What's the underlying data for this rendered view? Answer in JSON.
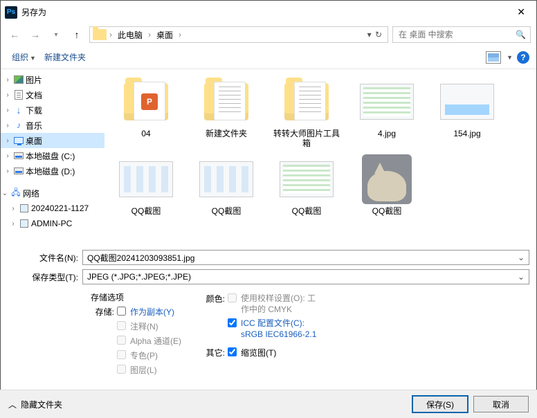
{
  "title": "另存为",
  "breadcrumb": {
    "pc": "此电脑",
    "loc": "桌面"
  },
  "search": {
    "placeholder": "在 桌面 中搜索"
  },
  "toolbar": {
    "organize": "组织",
    "newfolder": "新建文件夹"
  },
  "tree": {
    "pictures": "图片",
    "documents": "文档",
    "downloads": "下载",
    "music": "音乐",
    "desktop": "桌面",
    "disk_c": "本地磁盘 (C:)",
    "disk_d": "本地磁盘 (D:)",
    "network": "网络",
    "node1": "20240221-1127",
    "node2": "ADMIN-PC"
  },
  "items": [
    {
      "name": "04"
    },
    {
      "name": "新建文件夹"
    },
    {
      "name": "转转大师图片工具箱"
    },
    {
      "name": "4.jpg"
    },
    {
      "name": "154.jpg"
    },
    {
      "name": "QQ截图"
    },
    {
      "name": "QQ截图"
    },
    {
      "name": "QQ截图"
    },
    {
      "name": "QQ截图"
    }
  ],
  "fields": {
    "filename_label": "文件名(N):",
    "filename_value": "QQ截图20241203093851.jpg",
    "filetype_label": "保存类型(T):",
    "filetype_value": "JPEG (*.JPG;*.JPEG;*.JPE)"
  },
  "options": {
    "storage_heading": "存储选项",
    "storage_label": "存储:",
    "as_copy": "作为副本(Y)",
    "notes": "注释(N)",
    "alpha": "Alpha 通道(E)",
    "spot": "专色(P)",
    "layers": "图层(L)",
    "color_heading": "颜色:",
    "proof_line1": "使用校样设置(O): 工",
    "proof_line2": "作中的 CMYK",
    "icc_line1": "ICC 配置文件(C):",
    "icc_line2": "sRGB IEC61966-2.1",
    "other_heading": "其它:",
    "thumbnail": "缩览图(T)"
  },
  "footer": {
    "hide_folders": "隐藏文件夹",
    "save": "保存(S)",
    "cancel": "取消"
  }
}
